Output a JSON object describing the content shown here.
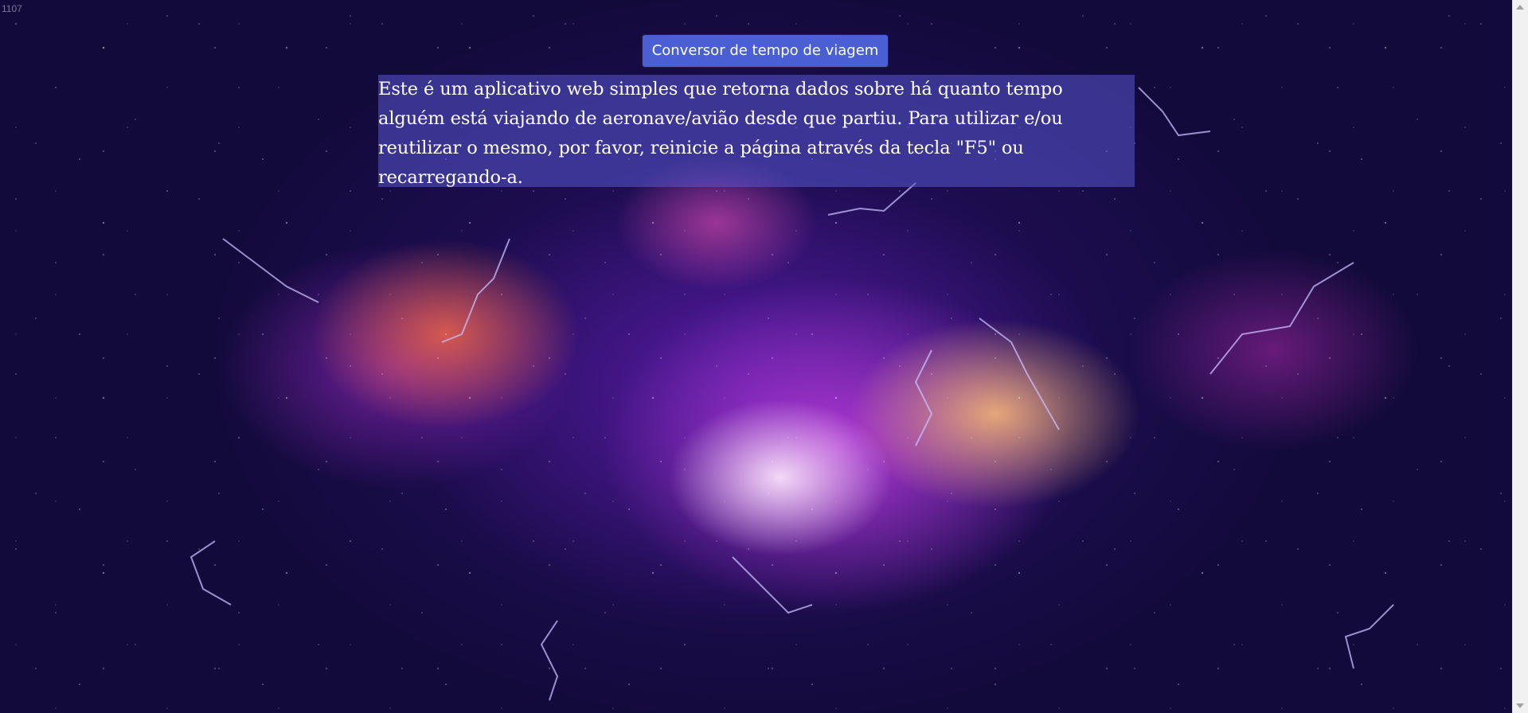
{
  "corner_label": "1107",
  "header": {
    "button_label": "Conversor de tempo de viagem"
  },
  "description": {
    "text": "Este é um aplicativo web simples que retorna dados sobre há quanto tempo alguém está viajando de aeronave/avião desde que partiu. Para utilizar e/ou reutilizar o mesmo, por favor, reinicie a página através da tecla \"F5\" ou recarregando-a."
  },
  "colors": {
    "button_background": "#4a5fd3",
    "description_box": "rgba(88, 88, 210, 0.55)",
    "text": "#ffffff"
  },
  "background": {
    "icon": "nebula-space-image"
  }
}
